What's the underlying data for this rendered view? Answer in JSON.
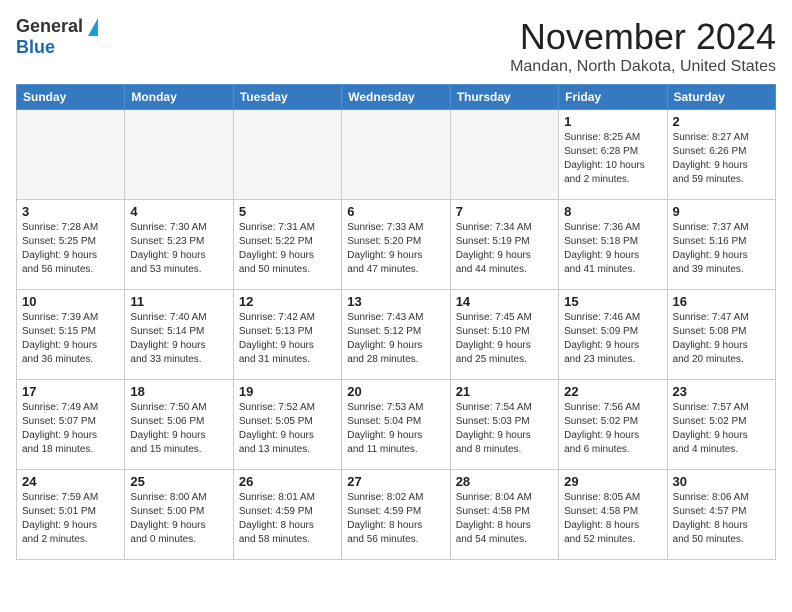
{
  "header": {
    "logo_general": "General",
    "logo_blue": "Blue",
    "month_title": "November 2024",
    "location": "Mandan, North Dakota, United States"
  },
  "weekdays": [
    "Sunday",
    "Monday",
    "Tuesday",
    "Wednesday",
    "Thursday",
    "Friday",
    "Saturday"
  ],
  "weeks": [
    [
      {
        "day": "",
        "info": "",
        "empty": true
      },
      {
        "day": "",
        "info": "",
        "empty": true
      },
      {
        "day": "",
        "info": "",
        "empty": true
      },
      {
        "day": "",
        "info": "",
        "empty": true
      },
      {
        "day": "",
        "info": "",
        "empty": true
      },
      {
        "day": "1",
        "info": "Sunrise: 8:25 AM\nSunset: 6:28 PM\nDaylight: 10 hours\nand 2 minutes."
      },
      {
        "day": "2",
        "info": "Sunrise: 8:27 AM\nSunset: 6:26 PM\nDaylight: 9 hours\nand 59 minutes."
      }
    ],
    [
      {
        "day": "3",
        "info": "Sunrise: 7:28 AM\nSunset: 5:25 PM\nDaylight: 9 hours\nand 56 minutes."
      },
      {
        "day": "4",
        "info": "Sunrise: 7:30 AM\nSunset: 5:23 PM\nDaylight: 9 hours\nand 53 minutes."
      },
      {
        "day": "5",
        "info": "Sunrise: 7:31 AM\nSunset: 5:22 PM\nDaylight: 9 hours\nand 50 minutes."
      },
      {
        "day": "6",
        "info": "Sunrise: 7:33 AM\nSunset: 5:20 PM\nDaylight: 9 hours\nand 47 minutes."
      },
      {
        "day": "7",
        "info": "Sunrise: 7:34 AM\nSunset: 5:19 PM\nDaylight: 9 hours\nand 44 minutes."
      },
      {
        "day": "8",
        "info": "Sunrise: 7:36 AM\nSunset: 5:18 PM\nDaylight: 9 hours\nand 41 minutes."
      },
      {
        "day": "9",
        "info": "Sunrise: 7:37 AM\nSunset: 5:16 PM\nDaylight: 9 hours\nand 39 minutes."
      }
    ],
    [
      {
        "day": "10",
        "info": "Sunrise: 7:39 AM\nSunset: 5:15 PM\nDaylight: 9 hours\nand 36 minutes."
      },
      {
        "day": "11",
        "info": "Sunrise: 7:40 AM\nSunset: 5:14 PM\nDaylight: 9 hours\nand 33 minutes."
      },
      {
        "day": "12",
        "info": "Sunrise: 7:42 AM\nSunset: 5:13 PM\nDaylight: 9 hours\nand 31 minutes."
      },
      {
        "day": "13",
        "info": "Sunrise: 7:43 AM\nSunset: 5:12 PM\nDaylight: 9 hours\nand 28 minutes."
      },
      {
        "day": "14",
        "info": "Sunrise: 7:45 AM\nSunset: 5:10 PM\nDaylight: 9 hours\nand 25 minutes."
      },
      {
        "day": "15",
        "info": "Sunrise: 7:46 AM\nSunset: 5:09 PM\nDaylight: 9 hours\nand 23 minutes."
      },
      {
        "day": "16",
        "info": "Sunrise: 7:47 AM\nSunset: 5:08 PM\nDaylight: 9 hours\nand 20 minutes."
      }
    ],
    [
      {
        "day": "17",
        "info": "Sunrise: 7:49 AM\nSunset: 5:07 PM\nDaylight: 9 hours\nand 18 minutes."
      },
      {
        "day": "18",
        "info": "Sunrise: 7:50 AM\nSunset: 5:06 PM\nDaylight: 9 hours\nand 15 minutes."
      },
      {
        "day": "19",
        "info": "Sunrise: 7:52 AM\nSunset: 5:05 PM\nDaylight: 9 hours\nand 13 minutes."
      },
      {
        "day": "20",
        "info": "Sunrise: 7:53 AM\nSunset: 5:04 PM\nDaylight: 9 hours\nand 11 minutes."
      },
      {
        "day": "21",
        "info": "Sunrise: 7:54 AM\nSunset: 5:03 PM\nDaylight: 9 hours\nand 8 minutes."
      },
      {
        "day": "22",
        "info": "Sunrise: 7:56 AM\nSunset: 5:02 PM\nDaylight: 9 hours\nand 6 minutes."
      },
      {
        "day": "23",
        "info": "Sunrise: 7:57 AM\nSunset: 5:02 PM\nDaylight: 9 hours\nand 4 minutes."
      }
    ],
    [
      {
        "day": "24",
        "info": "Sunrise: 7:59 AM\nSunset: 5:01 PM\nDaylight: 9 hours\nand 2 minutes."
      },
      {
        "day": "25",
        "info": "Sunrise: 8:00 AM\nSunset: 5:00 PM\nDaylight: 9 hours\nand 0 minutes."
      },
      {
        "day": "26",
        "info": "Sunrise: 8:01 AM\nSunset: 4:59 PM\nDaylight: 8 hours\nand 58 minutes."
      },
      {
        "day": "27",
        "info": "Sunrise: 8:02 AM\nSunset: 4:59 PM\nDaylight: 8 hours\nand 56 minutes."
      },
      {
        "day": "28",
        "info": "Sunrise: 8:04 AM\nSunset: 4:58 PM\nDaylight: 8 hours\nand 54 minutes."
      },
      {
        "day": "29",
        "info": "Sunrise: 8:05 AM\nSunset: 4:58 PM\nDaylight: 8 hours\nand 52 minutes."
      },
      {
        "day": "30",
        "info": "Sunrise: 8:06 AM\nSunset: 4:57 PM\nDaylight: 8 hours\nand 50 minutes."
      }
    ]
  ]
}
